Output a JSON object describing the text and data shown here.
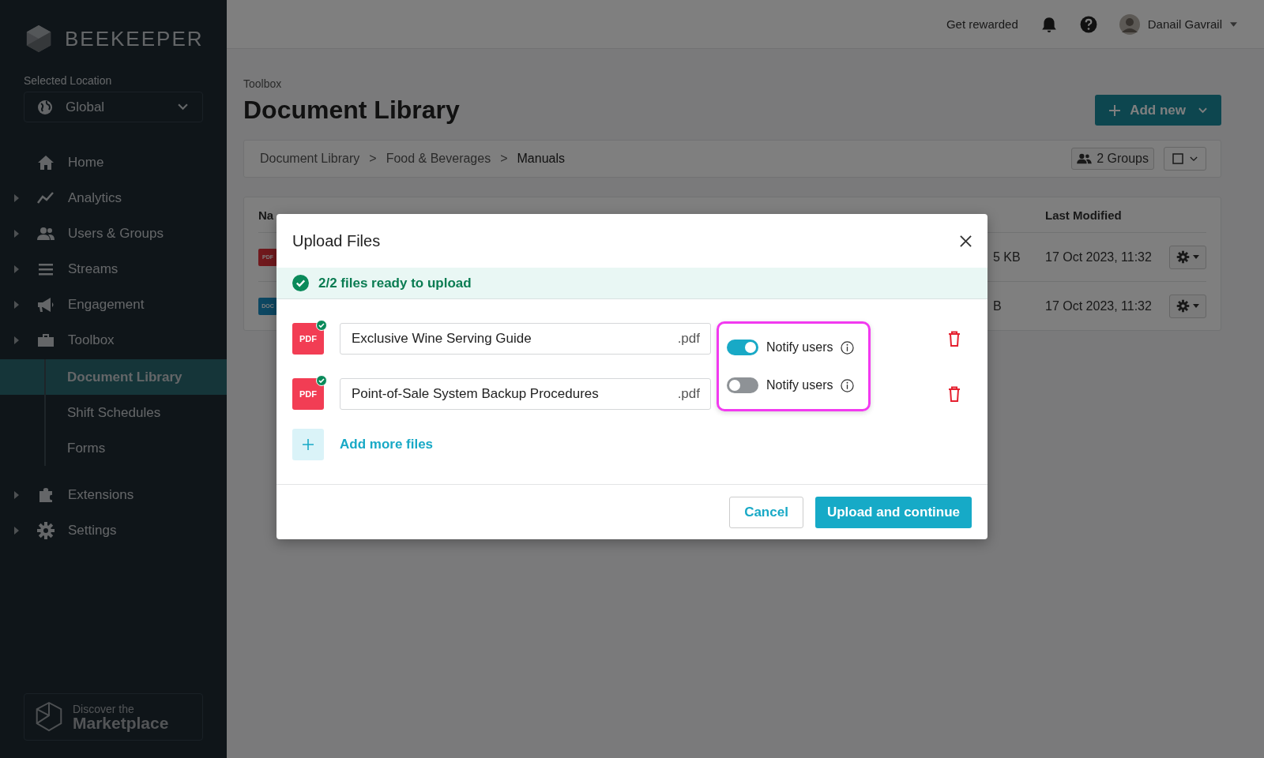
{
  "topbar": {
    "reward_link": "Get rewarded",
    "user_name": "Danail Gavrail"
  },
  "sidebar": {
    "brand": "BEEKEEPER",
    "location_label": "Selected Location",
    "location": "Global",
    "items": [
      {
        "label": "Home",
        "expandable": false
      },
      {
        "label": "Analytics",
        "expandable": true
      },
      {
        "label": "Users & Groups",
        "expandable": true
      },
      {
        "label": "Streams",
        "expandable": true
      },
      {
        "label": "Engagement",
        "expandable": true
      },
      {
        "label": "Toolbox",
        "expandable": true,
        "children": [
          {
            "label": "Document Library",
            "selected": true
          },
          {
            "label": "Shift Schedules",
            "selected": false
          },
          {
            "label": "Forms",
            "selected": false
          }
        ]
      },
      {
        "label": "Extensions",
        "expandable": true
      },
      {
        "label": "Settings",
        "expandable": true
      }
    ],
    "marketplace": {
      "line1": "Discover the",
      "line2": "Marketplace"
    }
  },
  "page": {
    "section": "Toolbox",
    "title": "Document Library",
    "add_button": "Add new",
    "breadcrumbs": [
      "Document Library",
      "Food & Beverages",
      "Manuals"
    ],
    "separator": ">",
    "groups": "2 Groups",
    "table": {
      "columns": [
        {
          "label": "Na"
        },
        {
          "label": "Last Modified"
        }
      ],
      "rows": [
        {
          "kind": "pdf",
          "type_label": "PDF",
          "size": "5 KB",
          "modified": "17 Oct 2023, 11:32"
        },
        {
          "kind": "doc",
          "type_label": "DOC",
          "size": "B",
          "modified": "17 Oct 2023, 11:32"
        }
      ]
    }
  },
  "modal": {
    "title": "Upload Files",
    "status": "2/2 files ready to upload",
    "files": [
      {
        "type_label": "PDF",
        "name": "Exclusive Wine Serving Guide",
        "extension": ".pdf",
        "notify": true,
        "notify_label": "Notify users"
      },
      {
        "type_label": "PDF",
        "name": "Point-of-Sale System Backup Procedures",
        "extension": ".pdf",
        "notify": false,
        "notify_label": "Notify users"
      }
    ],
    "add_more": "Add more files",
    "cancel": "Cancel",
    "submit": "Upload and continue"
  }
}
